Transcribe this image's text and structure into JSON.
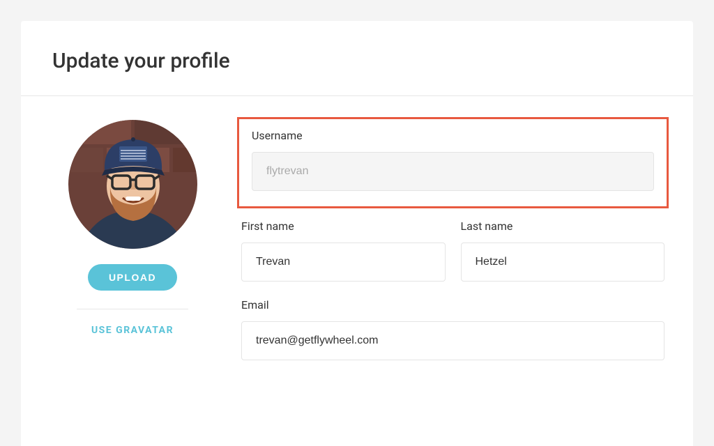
{
  "header": {
    "title": "Update your profile"
  },
  "avatar": {
    "upload_label": "UPLOAD",
    "gravatar_label": "USE GRAVATAR"
  },
  "form": {
    "username": {
      "label": "Username",
      "value": "flytrevan"
    },
    "first_name": {
      "label": "First name",
      "value": "Trevan"
    },
    "last_name": {
      "label": "Last name",
      "value": "Hetzel"
    },
    "email": {
      "label": "Email",
      "value": "trevan@getflywheel.com"
    }
  }
}
